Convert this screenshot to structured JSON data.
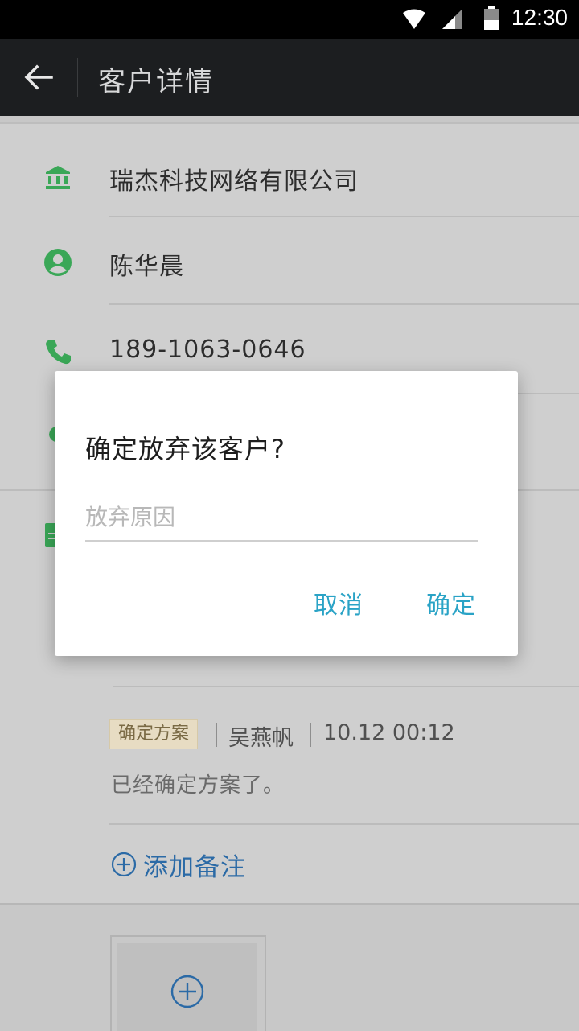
{
  "status_bar": {
    "time": "12:30",
    "icons": [
      "wifi-icon",
      "signal-icon",
      "battery-icon"
    ]
  },
  "app_bar": {
    "title": "客户详情",
    "back_icon": "arrow-back-icon"
  },
  "customer": {
    "company": "瑞杰科技网络有限公司",
    "contact_name": "陈华晨",
    "phone": "189-1063-0646"
  },
  "note": {
    "tag": "确定方案",
    "author": "吴燕帆",
    "time": "10.12 00:12",
    "content": "已经确定方案了。"
  },
  "add_note_label": "添加备注",
  "dialog": {
    "title": "确定放弃该客户?",
    "input_value": "",
    "input_placeholder": "放弃原因",
    "cancel_label": "取消",
    "confirm_label": "确定"
  },
  "colors": {
    "accent_green": "#3aa757",
    "dialog_button": "#2aa3c6",
    "link_blue": "#2b6aa6",
    "app_bar": "#1c1e20"
  }
}
